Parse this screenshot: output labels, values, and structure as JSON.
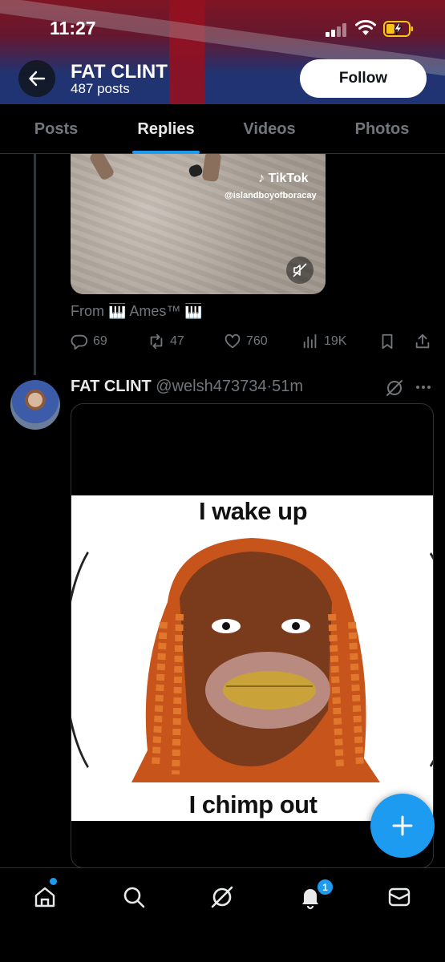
{
  "status_bar": {
    "time": "11:27"
  },
  "header": {
    "profile_name": "FAT CLINT",
    "post_count": "487 posts",
    "follow_label": "Follow"
  },
  "tabs": [
    {
      "label": "Posts",
      "active": false
    },
    {
      "label": "Replies",
      "active": true
    },
    {
      "label": "Videos",
      "active": false
    },
    {
      "label": "Photos",
      "active": false
    }
  ],
  "previous_tweet": {
    "media_watermark": "TikTok",
    "media_handle": "@islandboyofboracay",
    "from_line": "From 🎹 Ames™ 🎹",
    "replies": "69",
    "reposts": "47",
    "likes": "760",
    "views": "19K"
  },
  "tweet": {
    "author_name": "FAT CLINT",
    "author_handle": "@welsh473734",
    "separator": "·",
    "time_ago": "51m",
    "meme_top_text": "I wake up",
    "meme_bottom_text": "I chimp out"
  },
  "bottom_nav": {
    "notification_count": "1"
  },
  "colors": {
    "accent": "#1d9bf0",
    "background": "#000000",
    "muted_text": "#71767b",
    "primary_text": "#e7e9ea"
  },
  "icons": {
    "back": "back-arrow-icon",
    "mute": "muted-speaker-icon",
    "reply": "reply-bubble-icon",
    "repost": "repost-icon",
    "like": "heart-icon",
    "views": "analytics-bars-icon",
    "bookmark": "bookmark-icon",
    "share": "share-upload-icon",
    "grok": "grok-icon",
    "more": "more-dots-icon",
    "compose": "plus-icon",
    "nav": [
      "home-icon",
      "search-icon",
      "grok-icon",
      "bell-icon",
      "mail-icon"
    ]
  }
}
